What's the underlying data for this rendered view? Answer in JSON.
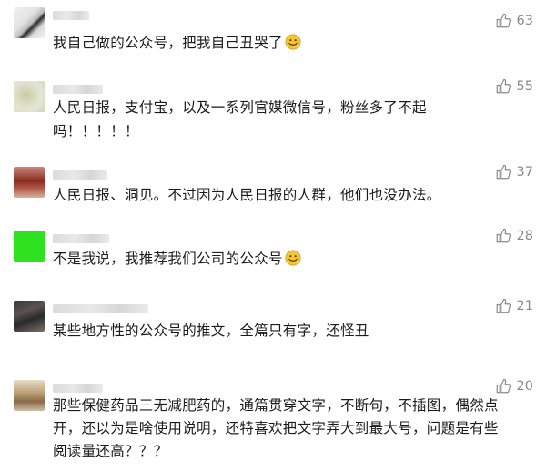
{
  "comments": [
    {
      "text": "我自己做的公众号，把我自己丑哭了",
      "likes": "63",
      "emoji": "smiling-emoji"
    },
    {
      "text": "人民日报，支付宝，以及一系列官媒微信号，粉丝多了不起\n吗！！！！！",
      "likes": "55"
    },
    {
      "text": "人民日报、洞见。不过因为人民日报的人群，他们也没办法。",
      "likes": "37"
    },
    {
      "text": "不是我说，我推荐我们公司的公众号",
      "likes": "28",
      "emoji": "smiling-emoji"
    },
    {
      "text": "某些地方性的公众号的推文，全篇只有字，还怪丑",
      "likes": "21"
    },
    {
      "text": "那些保健药品三无减肥药的，通篇贯穿文字，不断句，不插图，偶然点\n开，还以为是啥使用说明，还特喜欢把文字弄大到最大号，问题是有些\n阅读量还高？？？",
      "likes": "20"
    }
  ],
  "colors": {
    "text": "#1b1b1b",
    "like": "#8a8a8a",
    "avatar_green": "#2fe21f"
  }
}
